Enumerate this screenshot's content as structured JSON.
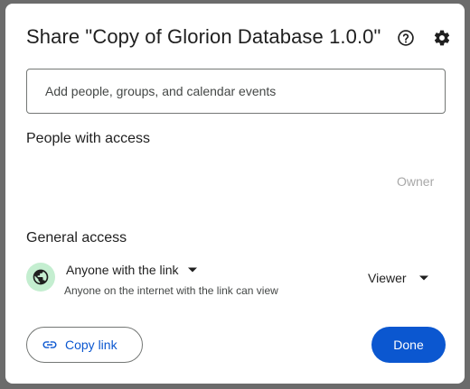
{
  "dialog": {
    "title": "Share \"Copy of Glorion Database 1.0.0\"",
    "help_icon": "help-circle-icon",
    "settings_icon": "gear-icon"
  },
  "add_people": {
    "placeholder": "Add people, groups, and calendar events",
    "value": ""
  },
  "people_with_access": {
    "heading": "People with access",
    "owner_label": "Owner"
  },
  "general_access": {
    "heading": "General access",
    "icon": "globe-icon",
    "selected_option": "Anyone with the link",
    "description": "Anyone on the internet with the link can view",
    "role": "Viewer"
  },
  "footer": {
    "copy_link_label": "Copy link",
    "copy_link_icon": "link-icon",
    "done_label": "Done"
  },
  "colors": {
    "primary": "#0b57d0",
    "globe_bg": "#c4eed0",
    "text": "#1f1f1f",
    "muted": "#a8a8a8"
  }
}
